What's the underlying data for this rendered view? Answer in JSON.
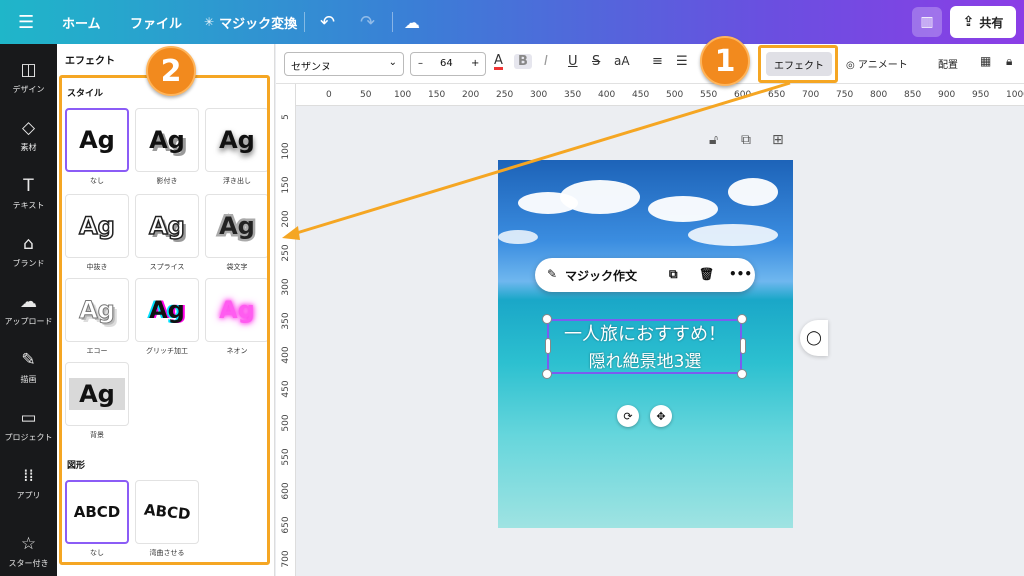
{
  "topbar": {
    "home": "ホーム",
    "file": "ファイル",
    "magic": "マジック変換",
    "share": "共有"
  },
  "rail": [
    {
      "label": "デザイン",
      "icon": "layout-icon"
    },
    {
      "label": "素材",
      "icon": "shapes-icon"
    },
    {
      "label": "テキスト",
      "icon": "text-icon"
    },
    {
      "label": "ブランド",
      "icon": "brand-icon"
    },
    {
      "label": "アップロード",
      "icon": "upload-icon"
    },
    {
      "label": "描画",
      "icon": "draw-icon"
    },
    {
      "label": "プロジェクト",
      "icon": "folder-icon"
    },
    {
      "label": "アプリ",
      "icon": "apps-icon"
    },
    {
      "label": "スター付き",
      "icon": "star-icon"
    }
  ],
  "panel": {
    "title": "エフェクト",
    "style_title": "スタイル",
    "shape_title": "図形",
    "sample": "Ag",
    "styles": [
      {
        "label": "なし",
        "cls": "ag-none"
      },
      {
        "label": "影付き",
        "cls": "ag-shadow"
      },
      {
        "label": "浮き出し",
        "cls": "ag-lift"
      },
      {
        "label": "中抜き",
        "cls": "ag-hollow"
      },
      {
        "label": "スプライス",
        "cls": "ag-splice"
      },
      {
        "label": "袋文字",
        "cls": "ag-outline"
      },
      {
        "label": "エコー",
        "cls": "ag-echo"
      },
      {
        "label": "グリッチ加工",
        "cls": "ag-glitch"
      },
      {
        "label": "ネオン",
        "cls": "ag-neon"
      },
      {
        "label": "背景",
        "cls": "ag-bg"
      }
    ],
    "shapes": [
      {
        "label": "なし",
        "text": "ABCD"
      },
      {
        "label": "湾曲させる",
        "text": "ABCD"
      }
    ]
  },
  "toolbar": {
    "font": "セザンヌ",
    "size": "64",
    "minus": "–",
    "plus": "+",
    "color_glyph": "A",
    "bold": "B",
    "italic": "I",
    "underline": "U",
    "strike": "S",
    "case": "aA",
    "effect": "エフェクト",
    "animate": "アニメート",
    "arrange": "配置"
  },
  "ruler_h": [
    "0",
    "50",
    "100",
    "150",
    "200",
    "250",
    "300",
    "350",
    "400",
    "450",
    "500",
    "550",
    "600",
    "650",
    "700",
    "750",
    "800",
    "850",
    "900",
    "950",
    "1000"
  ],
  "ruler_v": [
    "5",
    "100",
    "150",
    "200",
    "250",
    "300",
    "350",
    "400",
    "450",
    "500",
    "550",
    "600",
    "650",
    "700"
  ],
  "canvas": {
    "magic_write": "マジック作文",
    "text_line1": "一人旅におすすめ！",
    "text_line2": "隠れ絶景地3選"
  },
  "callouts": {
    "one": "1",
    "two": "2"
  },
  "colors": {
    "accent": "#f5a623",
    "selection": "#7b5cf0"
  }
}
